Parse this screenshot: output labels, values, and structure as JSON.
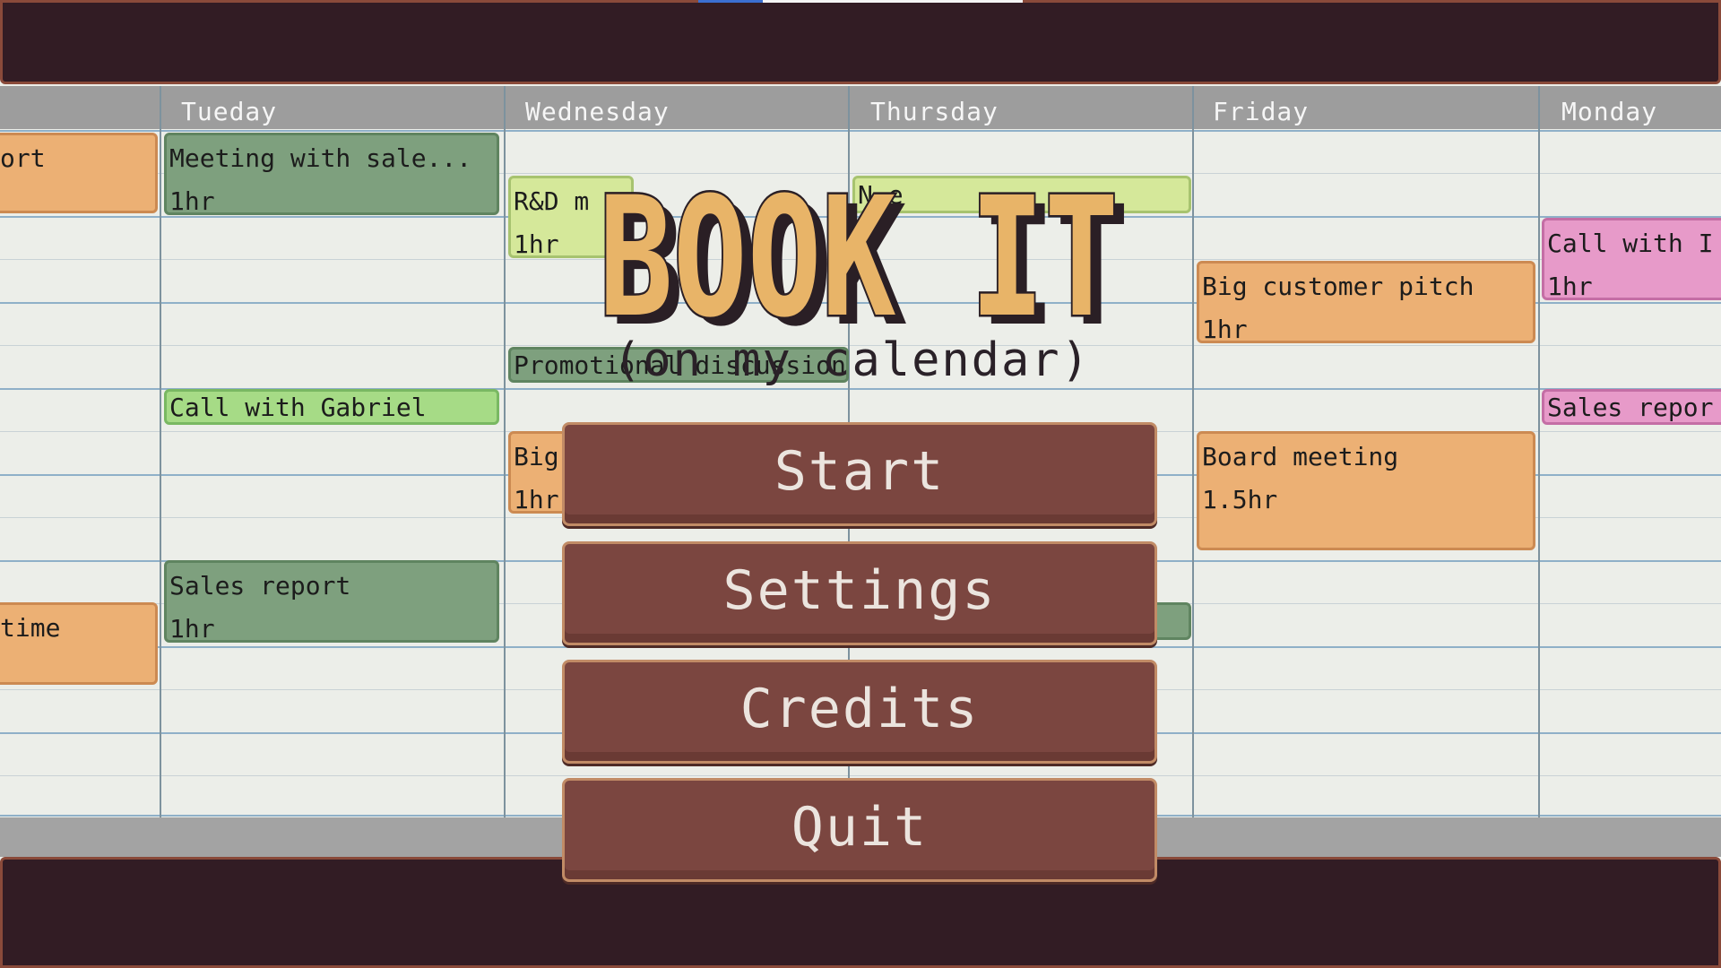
{
  "days": [
    "Tueday",
    "Wednesday",
    "Thursday",
    "Friday",
    "Monday"
  ],
  "events": {
    "monday_prev_report": {
      "title": "ort"
    },
    "monday_prev_time": {
      "title": "time"
    },
    "tue_meeting": {
      "title": "Meeting with sale...",
      "duration": "1hr"
    },
    "tue_call": {
      "title": "Call with Gabriel"
    },
    "tue_sales": {
      "title": "Sales report",
      "duration": "1hr"
    },
    "wed_rnd": {
      "title": "R&D m",
      "duration": "1hr"
    },
    "wed_promo": {
      "title": "Promotional discussion"
    },
    "wed_big": {
      "title": "Big",
      "duration": "1hr"
    },
    "thu_partial": {
      "title": "N           e"
    },
    "fri_pitch": {
      "title": "Big customer pitch",
      "duration": "1hr"
    },
    "fri_board": {
      "title": "Board meeting",
      "duration": "1.5hr"
    },
    "mon_call": {
      "title": "Call with I",
      "duration": "1hr"
    },
    "mon_sales": {
      "title": "Sales repor"
    }
  },
  "logo": {
    "title": "BOOK IT",
    "subtitle": "(on my calendar)"
  },
  "menu": {
    "start": "Start",
    "settings": "Settings",
    "credits": "Credits",
    "quit": "Quit"
  },
  "colors": {
    "frame": "#321c24",
    "button": "#7b4640",
    "logo_fill": "#e8b468",
    "event_orange": "#ecb074",
    "event_green": "#7ea07e",
    "event_lime": "#a6db86",
    "event_pink": "#e79ac9"
  }
}
